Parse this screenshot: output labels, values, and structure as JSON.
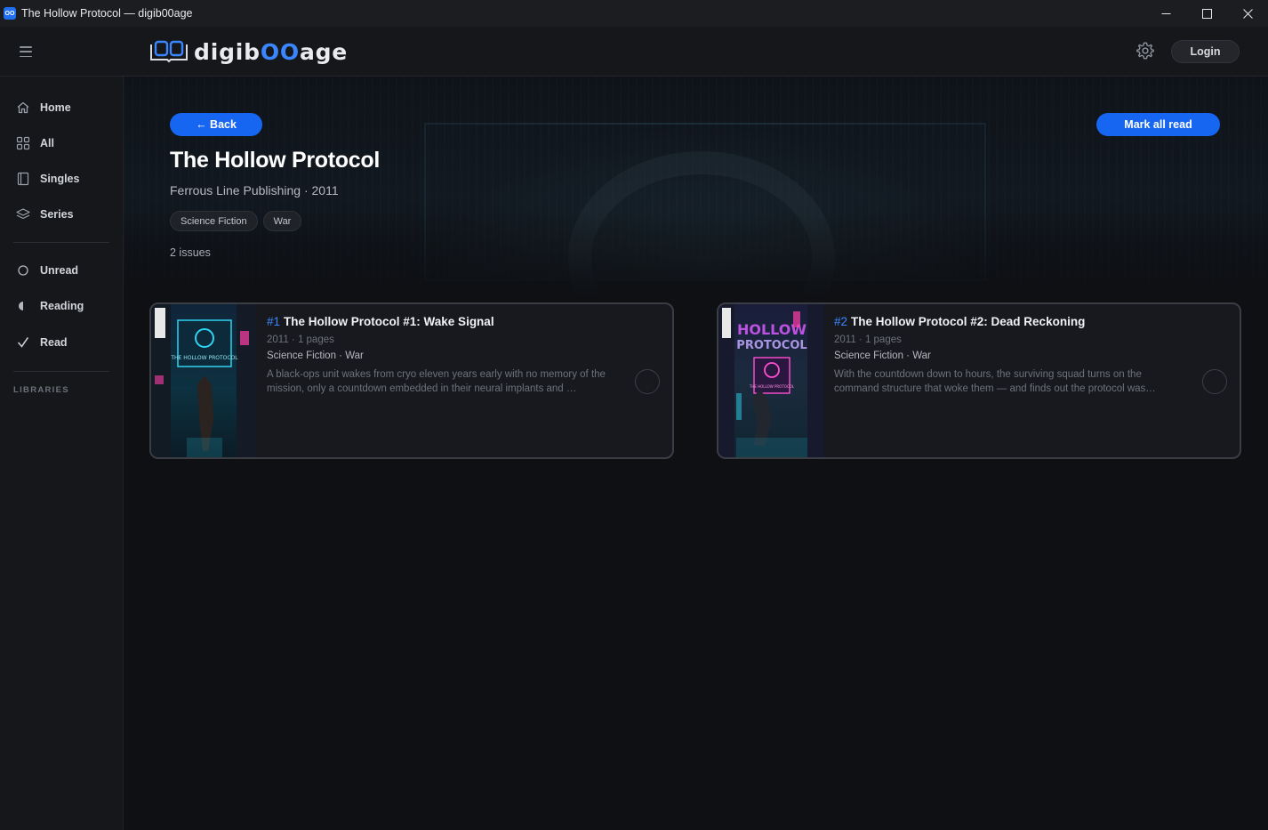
{
  "window": {
    "title": "The Hollow Protocol — digib00age",
    "app_icon_text": "OO"
  },
  "header": {
    "logo_prefix": "digib",
    "logo_oo": "OO",
    "logo_suffix": "age",
    "login_label": "Login"
  },
  "sidebar": {
    "items": [
      {
        "label": "Home",
        "icon": "home-icon"
      },
      {
        "label": "All",
        "icon": "grid-icon"
      },
      {
        "label": "Singles",
        "icon": "book-icon"
      },
      {
        "label": "Series",
        "icon": "layers-icon"
      }
    ],
    "status_items": [
      {
        "label": "Unread",
        "icon": "circle-outline-icon"
      },
      {
        "label": "Reading",
        "icon": "half-circle-icon"
      },
      {
        "label": "Read",
        "icon": "check-icon"
      }
    ],
    "libraries_label": "LIBRARIES"
  },
  "series": {
    "back_label": "← Back",
    "mark_all_label": "Mark all read",
    "title": "The Hollow Protocol",
    "meta": "Ferrous Line Publishing · 2011",
    "tags": [
      "Science Fiction",
      "War"
    ],
    "issue_count": "2 issues"
  },
  "issues": [
    {
      "number": "#1",
      "title": "The Hollow Protocol #1: Wake Signal",
      "meta": "2011 · 1 pages",
      "genres": "Science Fiction · War",
      "description": "A black-ops unit wakes from cryo eleven years early with no memory of the mission, only a countdown embedded in their neural implants and …",
      "cover_text": "THE HOLLOW PROTOCOL"
    },
    {
      "number": "#2",
      "title": "The Hollow Protocol #2: Dead Reckoning",
      "meta": "2011 · 1 pages",
      "genres": "Science Fiction · War",
      "description": "With the countdown down to hours, the surviving squad turns on the command structure that woke them — and finds out the protocol was…",
      "cover_text": "THE HOLLOW PROTOCOL"
    }
  ],
  "colors": {
    "accent": "#1766f2",
    "logo_accent": "#3a86ff",
    "background": "#0e1014",
    "sidebar": "#15171b"
  }
}
